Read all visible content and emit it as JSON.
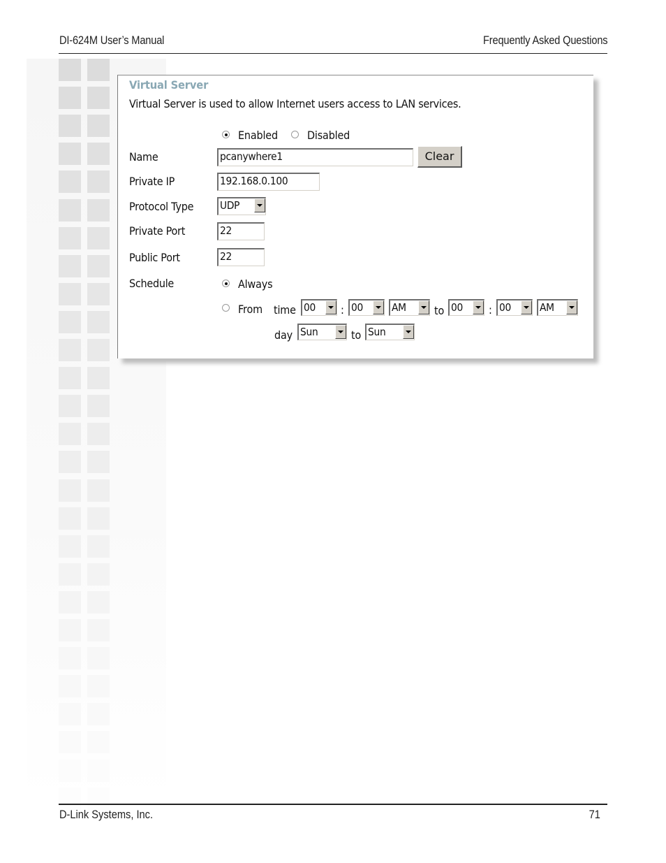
{
  "header": {
    "left": "DI-624M User’s Manual",
    "right": "Frequently Asked Questions"
  },
  "footer": {
    "left": "D-Link Systems, Inc.",
    "page_number": "71"
  },
  "panel": {
    "title": "Virtual Server",
    "description": "Virtual Server is used to allow Internet users access to LAN services.",
    "status": {
      "options": [
        {
          "label": "Enabled",
          "checked": true
        },
        {
          "label": "Disabled",
          "checked": false
        }
      ]
    },
    "fields": {
      "name": {
        "label": "Name",
        "value": "pcanywhere1"
      },
      "private_ip": {
        "label": "Private IP",
        "value": "192.168.0.100"
      },
      "protocol_type": {
        "label": "Protocol Type",
        "value": "UDP"
      },
      "private_port": {
        "label": "Private Port",
        "value": "22"
      },
      "public_port": {
        "label": "Public Port",
        "value": "22"
      }
    },
    "clear_button": "Clear",
    "schedule": {
      "label": "Schedule",
      "always_label": "Always",
      "always_checked": true,
      "from_label": "From",
      "from_checked": false,
      "time_label": "time",
      "colon": ":",
      "to_label": "to",
      "day_label": "day",
      "start_hour": "00",
      "start_minute": "00",
      "start_ampm": "AM",
      "end_hour": "00",
      "end_minute": "00",
      "end_ampm": "AM",
      "start_day": "Sun",
      "end_day": "Sun"
    }
  },
  "colors": {
    "panel_title": "#8aa8b4",
    "control_face": "#d4d0c8",
    "decor_square": "#dcdcdc"
  }
}
